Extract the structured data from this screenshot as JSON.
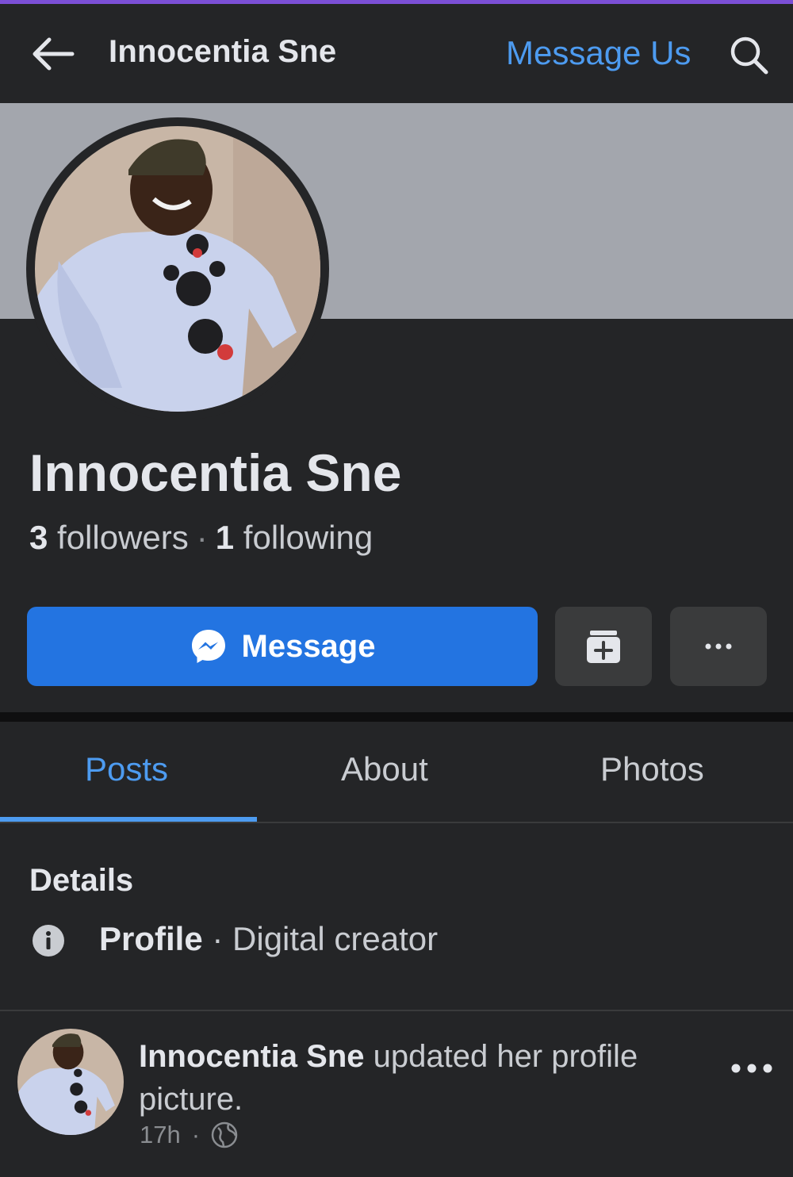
{
  "header": {
    "title": "Innocentia Sne",
    "message_us": "Message Us",
    "back_icon": "arrow-left-icon",
    "search_icon": "search-icon"
  },
  "profile": {
    "name": "Innocentia Sne",
    "followers_count": "3",
    "followers_label": "followers",
    "separator": "·",
    "following_count": "1",
    "following_label": "following"
  },
  "actions": {
    "message_label": "Message",
    "message_icon": "messenger-icon",
    "save_icon": "save-bookmark-icon",
    "more_icon": "more-icon"
  },
  "tabs": [
    {
      "label": "Posts",
      "active": true
    },
    {
      "label": "About",
      "active": false
    },
    {
      "label": "Photos",
      "active": false
    }
  ],
  "details": {
    "title": "Details",
    "category_label": "Profile",
    "separator": " · ",
    "category_value": "Digital creator",
    "info_icon": "info-icon"
  },
  "post": {
    "author": "Innocentia Sne",
    "action_text": " updated her profile picture.",
    "time": "17h",
    "separator": "·",
    "privacy_icon": "globe-icon",
    "more_icon": "more-icon"
  },
  "colors": {
    "accent": "#4d9bf0",
    "primary_button": "#2374e1",
    "background": "#242527",
    "cover": "#a3a6ad"
  }
}
